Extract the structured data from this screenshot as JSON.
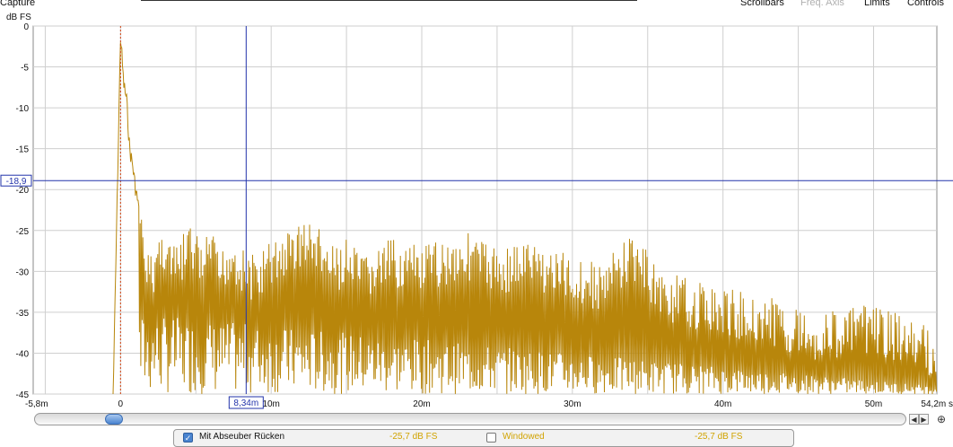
{
  "toolbar": {
    "capture_label": "Capture",
    "scrollbars_label": "Scrollbars",
    "freq_axis_label": "Freq. Axis",
    "limits_label": "Limits",
    "controls_label": "Controls"
  },
  "chart": {
    "unit_label": "dB FS",
    "y_ticks": [
      "0",
      "-5",
      "-10",
      "-15",
      "-20",
      "-25",
      "-30",
      "-35",
      "-40",
      "-45"
    ],
    "x_ticks": [
      "-5,8m",
      "0",
      "10m",
      "20m",
      "30m",
      "40m",
      "50m",
      "54,2m s"
    ],
    "cursor_y_label": "-18,9",
    "cursor_x_label": "8,34m",
    "trace_color": "#b8860b",
    "cursor_color": "#2233aa",
    "marker_color": "#d04010"
  },
  "chart_data": {
    "type": "line",
    "xlabel": "",
    "ylabel": "dB FS",
    "xlim": [
      -5.8,
      54.2
    ],
    "ylim": [
      -45,
      0
    ],
    "x_unit": "ms",
    "grid": true,
    "cursor": {
      "x": 8.34,
      "y": -18.9
    },
    "series": [
      {
        "color": "#b8860b",
        "x": [
          -0.5,
          0,
          0.1,
          0.2,
          0.4,
          0.6,
          0.8,
          1.0,
          1.3,
          1.6,
          2.0,
          2.5,
          3.0,
          3.5,
          4.0,
          4.5,
          5.0,
          5.5,
          6.0,
          6.5,
          7.0,
          7.5,
          8.0,
          9.0,
          10.0,
          11.0,
          12.0,
          13.0,
          14.0,
          15.0,
          16.0,
          18.0,
          20.0,
          22.0,
          23.0,
          25.0,
          27.0,
          30.0,
          32.0,
          34.0,
          36.0,
          38.0,
          40.0,
          43.0,
          46.0,
          50.0,
          54.0
        ],
        "y": [
          -45,
          0,
          -3,
          -6,
          -8,
          -14,
          -16,
          -19,
          -22,
          -26,
          -28,
          -25,
          -24,
          -27,
          -26,
          -24,
          -25,
          -27,
          -24,
          -28,
          -26,
          -25,
          -27,
          -28,
          -26,
          -25,
          -23.5,
          -24,
          -27,
          -26,
          -28,
          -26,
          -27,
          -25.5,
          -25,
          -27,
          -26,
          -28,
          -29,
          -25,
          -30,
          -31,
          -32,
          -33,
          -35,
          -34,
          -37
        ]
      }
    ]
  },
  "scrollbar": {
    "left_arrow": "◀",
    "right_arrow": "▶",
    "zoom_icon": "⊕"
  },
  "bottom_panel": {
    "mit_label": "Mit Abseuber Rücken",
    "mit_value": "-25,7 dB FS",
    "windowed_label": "Windowed",
    "windowed_value": "-25,7 dB FS",
    "check_mark": "✓"
  }
}
